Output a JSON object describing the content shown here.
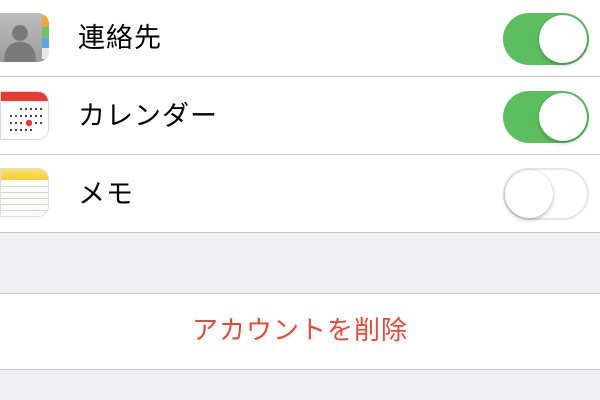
{
  "sync_items": [
    {
      "label": "連絡先",
      "icon": "contacts-icon",
      "enabled": true
    },
    {
      "label": "カレンダー",
      "icon": "calendar-icon",
      "enabled": true
    },
    {
      "label": "メモ",
      "icon": "notes-icon",
      "enabled": false
    }
  ],
  "delete_account": {
    "label": "アカウントを削除"
  },
  "colors": {
    "toggle_on": "#5bbf5e",
    "destructive": "#e04b3c",
    "background": "#efeff4"
  }
}
